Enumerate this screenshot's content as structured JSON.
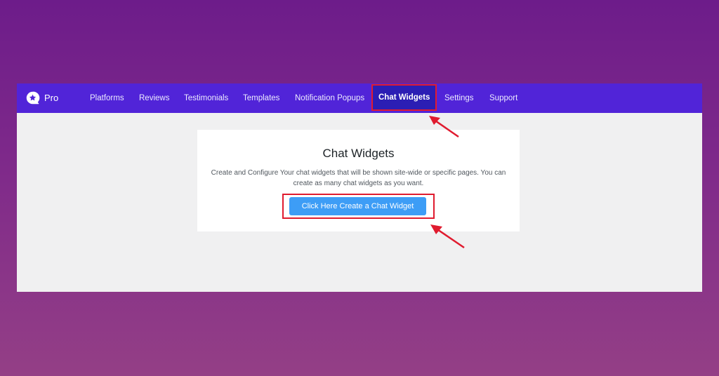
{
  "brand": {
    "logo_icon": "chat-star-icon",
    "name": "Pro"
  },
  "nav": {
    "items": [
      {
        "label": "Platforms"
      },
      {
        "label": "Reviews"
      },
      {
        "label": "Testimonials"
      },
      {
        "label": "Templates"
      },
      {
        "label": "Notification Popups"
      },
      {
        "label": "Chat Widgets",
        "active": true
      },
      {
        "label": "Settings"
      },
      {
        "label": "Support"
      }
    ]
  },
  "page": {
    "title": "Chat Widgets",
    "description": "Create and Configure Your chat widgets that will be shown site-wide or specific pages. You can create as many chat widgets as you want.",
    "cta_label": "Click Here Create a Chat Widget"
  },
  "annotations": {
    "highlight_color": "#e01b2f",
    "arrows": [
      "arrow-to-chat-widgets-tab",
      "arrow-to-create-button"
    ]
  },
  "colors": {
    "navbar": "#5124d8",
    "active_tab": "#2b1eb4",
    "button": "#3d9df6"
  }
}
